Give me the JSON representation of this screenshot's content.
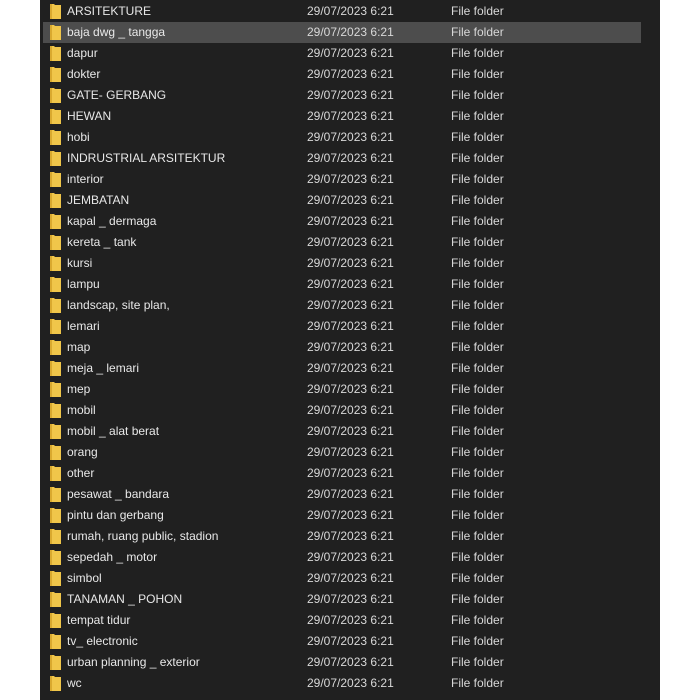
{
  "colors": {
    "background": "#202020",
    "selected": "#4d4d4d",
    "folder": "#f0c64a"
  },
  "selected_index": 1,
  "files": [
    {
      "name": "ARSITEKTURE",
      "date": "29/07/2023 6:21",
      "type": "File folder"
    },
    {
      "name": "baja dwg _ tangga",
      "date": "29/07/2023 6:21",
      "type": "File folder"
    },
    {
      "name": "dapur",
      "date": "29/07/2023 6:21",
      "type": "File folder"
    },
    {
      "name": "dokter",
      "date": "29/07/2023 6:21",
      "type": "File folder"
    },
    {
      "name": "GATE- GERBANG",
      "date": "29/07/2023 6:21",
      "type": "File folder"
    },
    {
      "name": "HEWAN",
      "date": "29/07/2023 6:21",
      "type": "File folder"
    },
    {
      "name": "hobi",
      "date": "29/07/2023 6:21",
      "type": "File folder"
    },
    {
      "name": "INDRUSTRIAL ARSITEKTUR",
      "date": "29/07/2023 6:21",
      "type": "File folder"
    },
    {
      "name": "interior",
      "date": "29/07/2023 6:21",
      "type": "File folder"
    },
    {
      "name": "JEMBATAN",
      "date": "29/07/2023 6:21",
      "type": "File folder"
    },
    {
      "name": "kapal _ dermaga",
      "date": "29/07/2023 6:21",
      "type": "File folder"
    },
    {
      "name": "kereta _ tank",
      "date": "29/07/2023 6:21",
      "type": "File folder"
    },
    {
      "name": "kursi",
      "date": "29/07/2023 6:21",
      "type": "File folder"
    },
    {
      "name": "lampu",
      "date": "29/07/2023 6:21",
      "type": "File folder"
    },
    {
      "name": "landscap, site plan,",
      "date": "29/07/2023 6:21",
      "type": "File folder"
    },
    {
      "name": "lemari",
      "date": "29/07/2023 6:21",
      "type": "File folder"
    },
    {
      "name": "map",
      "date": "29/07/2023 6:21",
      "type": "File folder"
    },
    {
      "name": "meja _ lemari",
      "date": "29/07/2023 6:21",
      "type": "File folder"
    },
    {
      "name": "mep",
      "date": "29/07/2023 6:21",
      "type": "File folder"
    },
    {
      "name": "mobil",
      "date": "29/07/2023 6:21",
      "type": "File folder"
    },
    {
      "name": "mobil _ alat berat",
      "date": "29/07/2023 6:21",
      "type": "File folder"
    },
    {
      "name": "orang",
      "date": "29/07/2023 6:21",
      "type": "File folder"
    },
    {
      "name": "other",
      "date": "29/07/2023 6:21",
      "type": "File folder"
    },
    {
      "name": "pesawat _ bandara",
      "date": "29/07/2023 6:21",
      "type": "File folder"
    },
    {
      "name": "pintu dan gerbang",
      "date": "29/07/2023 6:21",
      "type": "File folder"
    },
    {
      "name": "rumah, ruang public, stadion",
      "date": "29/07/2023 6:21",
      "type": "File folder"
    },
    {
      "name": "sepedah _ motor",
      "date": "29/07/2023 6:21",
      "type": "File folder"
    },
    {
      "name": "simbol",
      "date": "29/07/2023 6:21",
      "type": "File folder"
    },
    {
      "name": "TANAMAN _ POHON",
      "date": "29/07/2023 6:21",
      "type": "File folder"
    },
    {
      "name": "tempat tidur",
      "date": "29/07/2023 6:21",
      "type": "File folder"
    },
    {
      "name": "tv_ electronic",
      "date": "29/07/2023 6:21",
      "type": "File folder"
    },
    {
      "name": "urban planning _ exterior",
      "date": "29/07/2023 6:21",
      "type": "File folder"
    },
    {
      "name": "wc",
      "date": "29/07/2023 6:21",
      "type": "File folder"
    }
  ]
}
